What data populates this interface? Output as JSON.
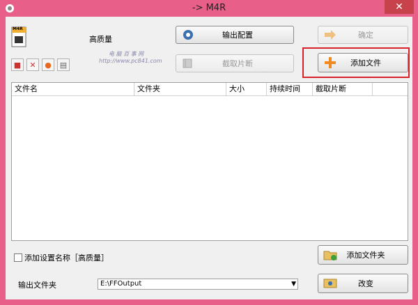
{
  "window": {
    "title": "-> M4R",
    "close_glyph": "✕"
  },
  "profile": {
    "quality_label": "高质量",
    "format_badge": "M4R"
  },
  "buttons": {
    "output_config": "输出配置",
    "ok": "确定",
    "clip": "截取片断",
    "add_file": "添加文件",
    "add_folder": "添加文件夹",
    "change": "改变"
  },
  "table": {
    "columns": [
      "文件名",
      "文件夹",
      "大小",
      "持续时间",
      "截取片断"
    ]
  },
  "options": {
    "add_setting_name": "添加设置名称［高质量］"
  },
  "output": {
    "label": "输出文件夹",
    "path": "E:\\FFOutput"
  },
  "watermark": {
    "line1": "电 脑 百 事 网",
    "line2": "http://www.pc841.com"
  },
  "colors": {
    "frame": "#e8608a",
    "highlight": "#d8202a",
    "close": "#c7424a"
  }
}
